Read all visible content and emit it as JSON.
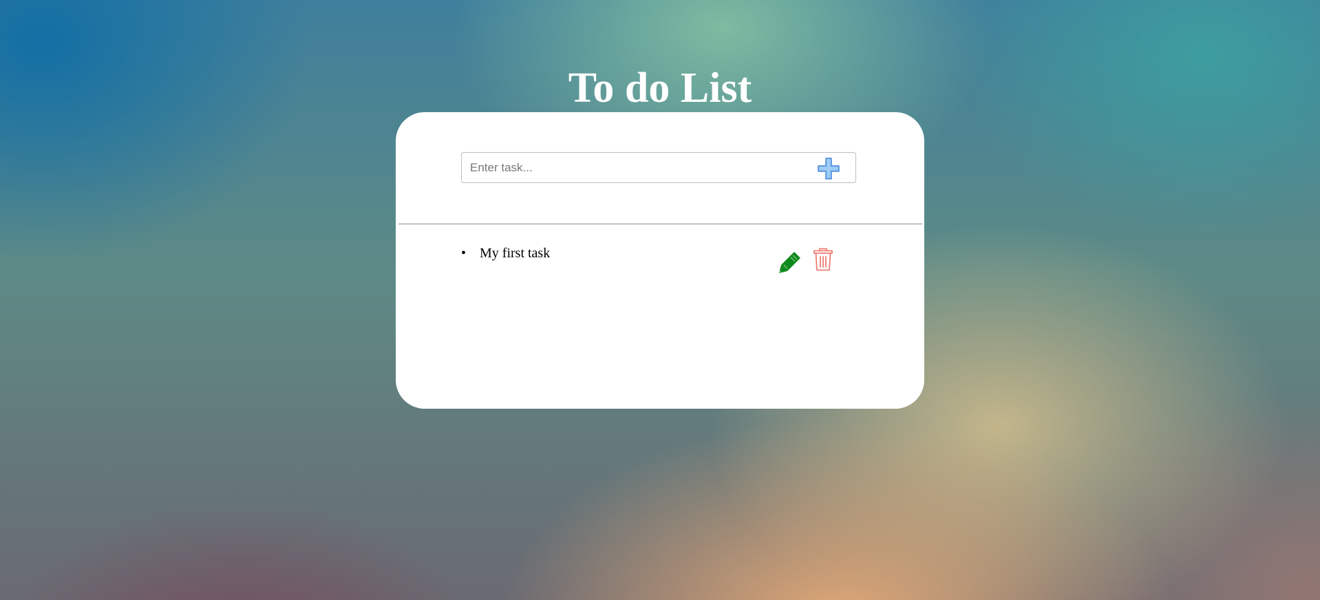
{
  "header": {
    "title": "To do List"
  },
  "task_form": {
    "placeholder": "Enter task...",
    "value": "",
    "add_icon": "plus-icon",
    "add_icon_color": "#6fb0ee"
  },
  "tasks": [
    {
      "text": "My first task",
      "edit_icon": "pencil-icon",
      "edit_color": "#0f8a1c",
      "delete_icon": "trash-icon",
      "delete_color": "#ef7c72"
    }
  ]
}
